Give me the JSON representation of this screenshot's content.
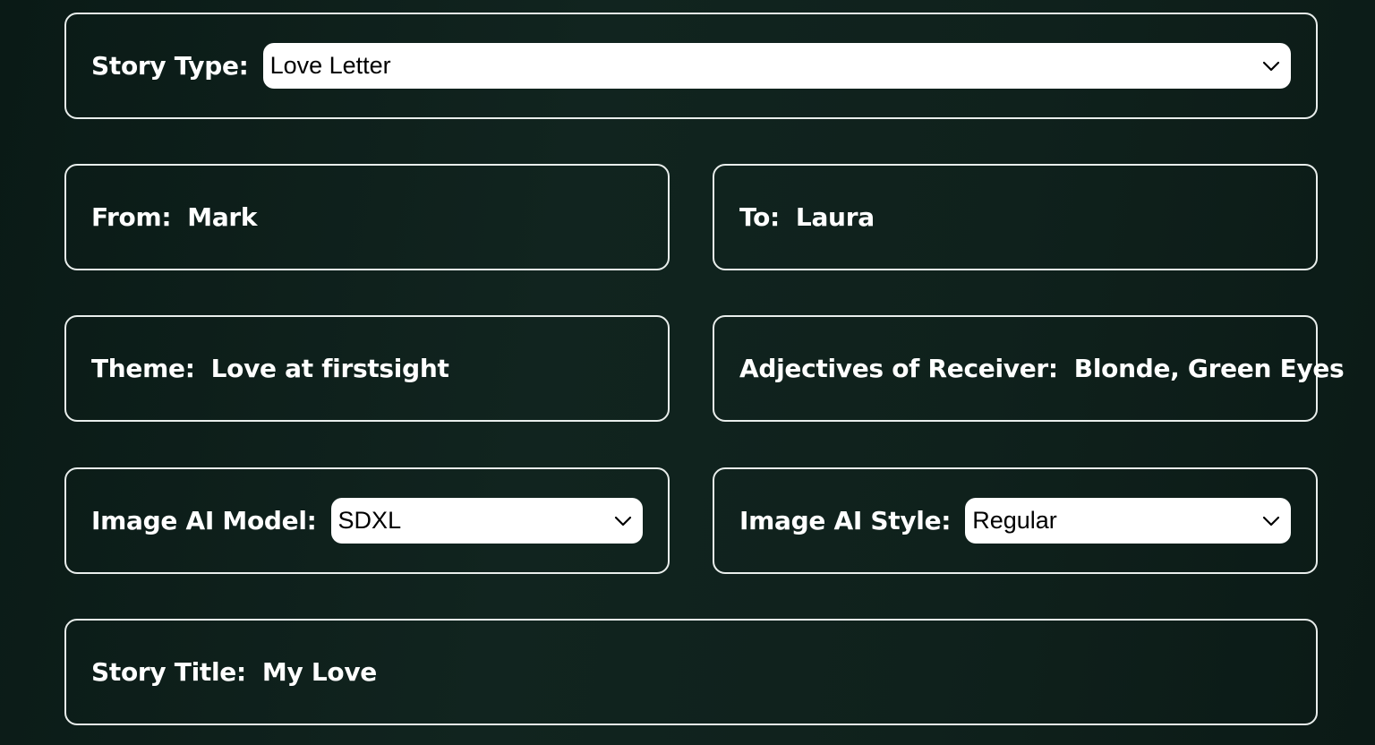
{
  "story_type": {
    "label": "Story Type:",
    "value": "Love Letter"
  },
  "from": {
    "label": "From:",
    "value": "Mark"
  },
  "to": {
    "label": "To:",
    "value": "Laura"
  },
  "theme": {
    "label": "Theme:",
    "value": "Love at firstsight"
  },
  "adjectives": {
    "label": "Adjectives of Receiver:",
    "value": "Blonde, Green Eyes"
  },
  "image_model": {
    "label": "Image AI Model:",
    "value": "SDXL"
  },
  "image_style": {
    "label": "Image AI Style:",
    "value": "Regular"
  },
  "story_title": {
    "label": "Story Title:",
    "value": "My Love"
  },
  "icons": {
    "select_chevron": "chevron-down-icon"
  },
  "colors": {
    "border": "#e9eeec",
    "background": "#0f211c",
    "select_bg": "#ffffff"
  }
}
